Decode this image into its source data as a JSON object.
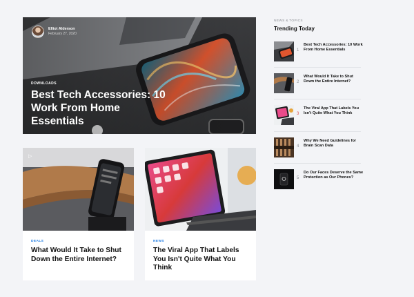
{
  "hero": {
    "author_name": "Elliot Alderson",
    "author_date": "February 27, 2020",
    "category": "DOWNLOADS",
    "title": "Best Tech Accessories: 10 Work From Home Essentials"
  },
  "cards": [
    {
      "category": "DEALS",
      "title": "What Would It Take to Shut Down the Entire Internet?"
    },
    {
      "category": "NEWS",
      "title": "The Viral App That Labels You Isn't Quite What You Think"
    }
  ],
  "sidebar": {
    "kicker": "NEWS & TOPICS",
    "title": "Trending Today",
    "items": [
      {
        "num": "1",
        "title": "Best Tech Accessories: 10 Work From Home Essentials"
      },
      {
        "num": "2",
        "title": "What Would It Take to Shut Down the Entire Internet?"
      },
      {
        "num": "3",
        "title": "The Viral App That Labels You Isn't Quite What You Think"
      },
      {
        "num": "4",
        "title": "Why We Need Guidelines for Brain Scan Data"
      },
      {
        "num": "5",
        "title": "Do Our Faces Deserve the Same Protection as Our Phones?"
      }
    ]
  },
  "colors": {
    "accent": "#1d7be3",
    "number_3": "#d9534f"
  }
}
